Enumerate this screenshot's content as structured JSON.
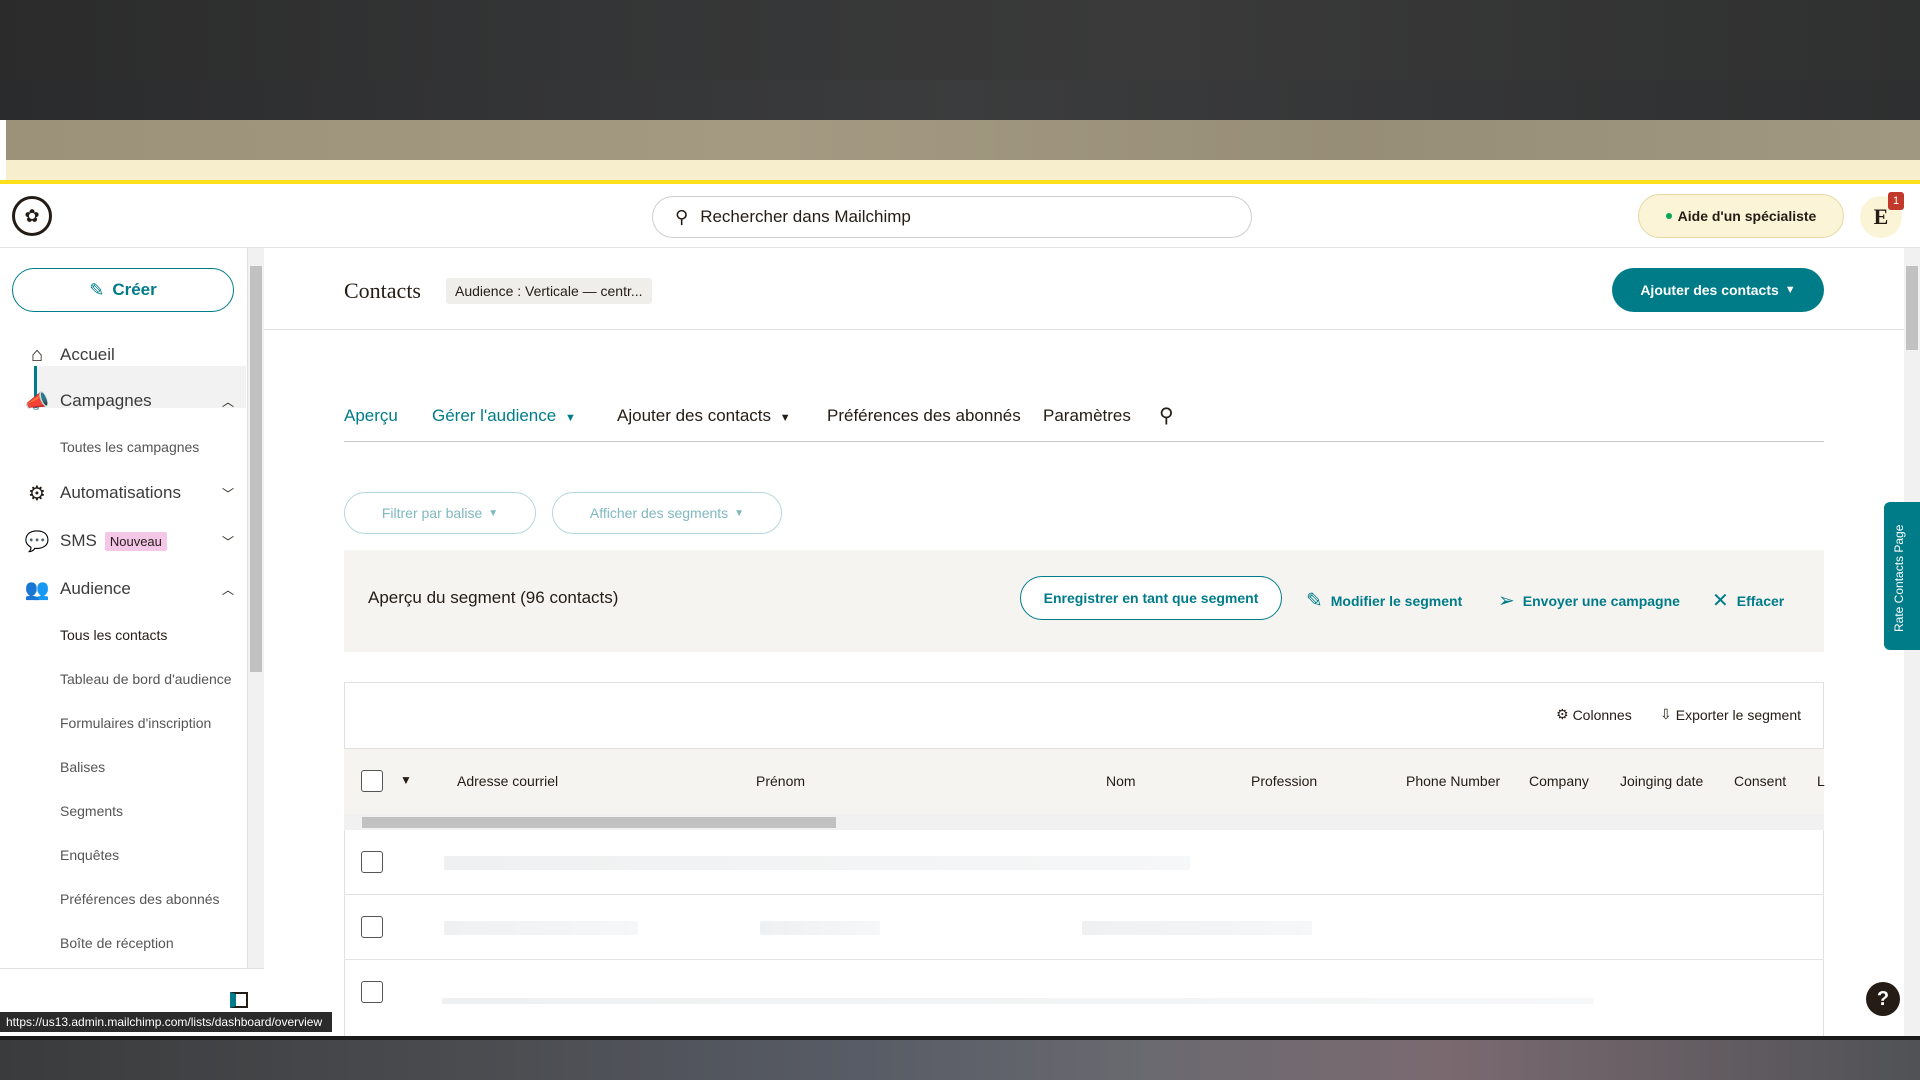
{
  "header": {
    "search_placeholder": "Rechercher dans Mailchimp",
    "help_label": "Aide d'un spécialiste",
    "avatar_initial": "E",
    "notification_count": "1"
  },
  "sidebar": {
    "create_label": "Créer",
    "items": [
      {
        "label": "Accueil",
        "icon": "home-icon"
      },
      {
        "label": "Campagnes",
        "icon": "megaphone-icon"
      },
      {
        "label": "Toutes les campagnes"
      },
      {
        "label": "Automatisations",
        "icon": "automation-icon"
      },
      {
        "label": "SMS",
        "icon": "sms-icon",
        "badge": "Nouveau"
      },
      {
        "label": "Audience",
        "icon": "audience-icon"
      },
      {
        "label": "Tous les contacts"
      },
      {
        "label": "Tableau de bord d'audience"
      },
      {
        "label": "Formulaires d'inscription"
      },
      {
        "label": "Balises"
      },
      {
        "label": "Segments"
      },
      {
        "label": "Enquêtes"
      },
      {
        "label": "Préférences des abonnés"
      },
      {
        "label": "Boîte de réception"
      }
    ]
  },
  "status_url": "https://us13.admin.mailchimp.com/lists/dashboard/overview",
  "main": {
    "title": "Contacts",
    "audience_tag": "Audience : Verticale — centr...",
    "add_contacts_label": "Ajouter des contacts",
    "tabs": [
      {
        "label": "Aperçu"
      },
      {
        "label": "Gérer l'audience"
      },
      {
        "label": "Ajouter des contacts"
      },
      {
        "label": "Préférences des abonnés"
      },
      {
        "label": "Paramètres"
      }
    ],
    "filter_tag_label": "Filtrer par balise",
    "segments_label": "Afficher des segments",
    "segment": {
      "title": "Aperçu du segment (96 contacts)",
      "save_label": "Enregistrer en tant que segment",
      "edit_label": "Modifier le segment",
      "send_label": "Envoyer une campagne",
      "clear_label": "Effacer"
    },
    "table": {
      "columns_label": "Colonnes",
      "export_label": "Exporter le segment",
      "headers": [
        "Adresse courriel",
        "Prénom",
        "Nom",
        "Profession",
        "Phone Number",
        "Company",
        "Joinging date",
        "Consent",
        "L"
      ]
    },
    "rate_label": "Rate Contacts Page"
  },
  "colors": {
    "accent": "#007c89",
    "brand_yellow": "#ffe01b"
  }
}
